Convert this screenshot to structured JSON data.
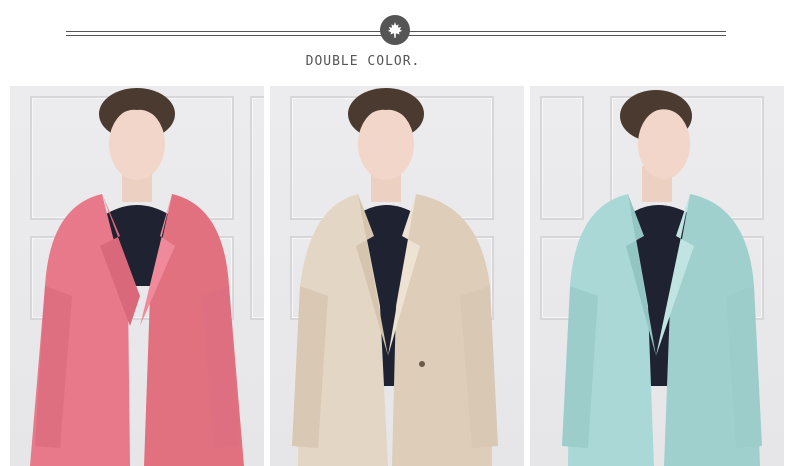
{
  "header": {
    "title": "DOUBLE COLOR.",
    "emblem_icon": "maple-leaf-icon"
  },
  "colors": {
    "pink": "#e7798a",
    "beige": "#e4d6c4",
    "mint": "#a9d8d6",
    "hair": "#4b3a30",
    "skin": "#f1d6c9",
    "inner": "#1f2230"
  },
  "products": [
    {
      "color_name": "pink",
      "coat_color": "#e7798a"
    },
    {
      "color_name": "beige",
      "coat_color": "#e4d6c4"
    },
    {
      "color_name": "mint",
      "coat_color": "#a9d8d6"
    }
  ]
}
